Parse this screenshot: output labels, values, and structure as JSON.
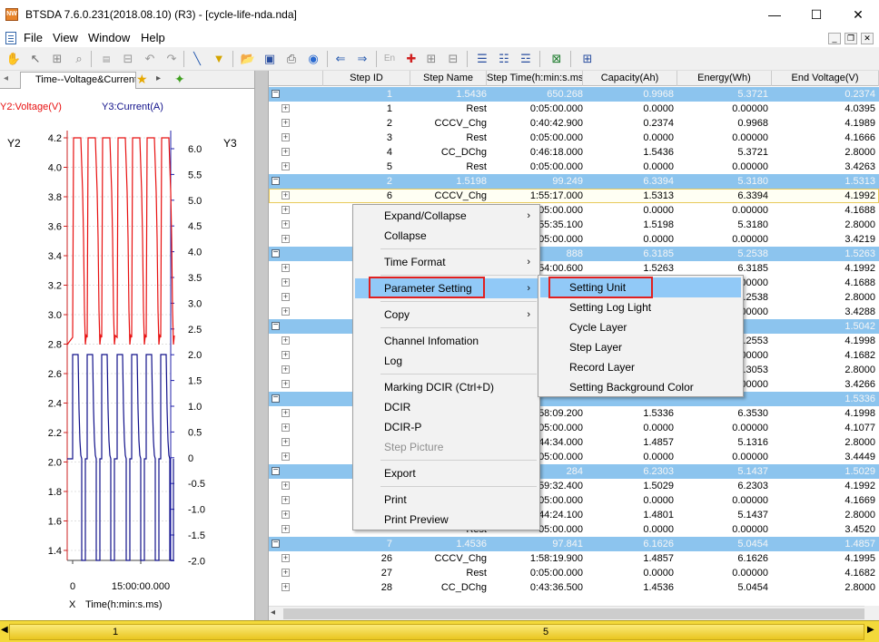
{
  "window": {
    "title": "BTSDA 7.6.0.231(2018.08.10) (R3) - [cycle-life-nda.nda]",
    "app_icon_text": "NW",
    "minimize": "—",
    "maximize": "☐",
    "close": "✕"
  },
  "menubar": {
    "items": [
      "File",
      "View",
      "Window",
      "Help"
    ]
  },
  "chart": {
    "tab_label": "Time--Voltage&Current",
    "y2_legend": "Y2:Voltage(V)",
    "y3_legend": "Y3:Current(A)",
    "y2_title": "Y2",
    "y3_title": "Y3",
    "x_prefix": "X",
    "x_title": "Time(h:min:s.ms)",
    "x_ticks": [
      "0",
      "15:00:00.000"
    ],
    "y2_ticks": [
      "4.2",
      "4.0",
      "3.8",
      "3.6",
      "3.4",
      "3.2",
      "3.0",
      "2.8",
      "2.6",
      "2.4",
      "2.2",
      "2.0",
      "1.8",
      "1.6",
      "1.4"
    ],
    "y3_ticks": [
      "6.0",
      "5.5",
      "5.0",
      "4.5",
      "4.0",
      "3.5",
      "3.0",
      "2.5",
      "2.0",
      "1.5",
      "1.0",
      "0.5",
      "0",
      "-0.5",
      "-1.0",
      "-1.5",
      "-2.0"
    ],
    "colors": {
      "voltage": "#e81010",
      "current": "#10108a",
      "y2_axis": "#cc2020",
      "y3_axis": "#2020aa"
    }
  },
  "table": {
    "columns": [
      "Step ID",
      "Step Name",
      "Step Time(h:min:s.ms)",
      "Capacity(Ah)",
      "Energy(Wh)",
      "End Voltage(V)"
    ],
    "rows": [
      {
        "type": "cycle",
        "id": "1",
        "name": "1.5436",
        "time": "650.268",
        "cap": "0.9968",
        "energy": "5.3721",
        "endv": "0.2374"
      },
      {
        "type": "step",
        "id": "1",
        "name": "Rest",
        "time": "0:05:00.000",
        "cap": "0.0000",
        "energy": "0.00000",
        "endv": "4.0395"
      },
      {
        "type": "step",
        "id": "2",
        "name": "CCCV_Chg",
        "time": "0:40:42.900",
        "cap": "0.2374",
        "energy": "0.9968",
        "endv": "4.1989"
      },
      {
        "type": "step",
        "id": "3",
        "name": "Rest",
        "time": "0:05:00.000",
        "cap": "0.0000",
        "energy": "0.00000",
        "endv": "4.1666"
      },
      {
        "type": "step",
        "id": "4",
        "name": "CC_DChg",
        "time": "0:46:18.000",
        "cap": "1.5436",
        "energy": "5.3721",
        "endv": "2.8000"
      },
      {
        "type": "step",
        "id": "5",
        "name": "Rest",
        "time": "0:05:00.000",
        "cap": "0.0000",
        "energy": "0.00000",
        "endv": "3.4263"
      },
      {
        "type": "cycle",
        "id": "2",
        "name": "1.5198",
        "time": "99.249",
        "cap": "6.3394",
        "energy": "5.3180",
        "endv": "1.5313"
      },
      {
        "type": "step",
        "sel": true,
        "id": "6",
        "name": "CCCV_Chg",
        "time": "1:55:17.000",
        "cap": "1.5313",
        "energy": "6.3394",
        "endv": "4.1992"
      },
      {
        "type": "step",
        "id": "",
        "name": "",
        "time": "05:00.000",
        "cap": "0.0000",
        "energy": "0.00000",
        "endv": "4.1688"
      },
      {
        "type": "step",
        "id": "",
        "name": "",
        "time": "55:35.100",
        "cap": "1.5198",
        "energy": "5.3180",
        "endv": "2.8000"
      },
      {
        "type": "step",
        "id": "",
        "name": "",
        "time": "05:00.000",
        "cap": "0.0000",
        "energy": "0.00000",
        "endv": "3.4219"
      },
      {
        "type": "cycle",
        "id": "",
        "name": "",
        "time": "888",
        "cap": "6.3185",
        "energy": "5.2538",
        "endv": "1.5263"
      },
      {
        "type": "step",
        "id": "",
        "name": "",
        "time": "54:00.600",
        "cap": "1.5263",
        "energy": "6.3185",
        "endv": "4.1992"
      },
      {
        "type": "step",
        "id": "",
        "name": "",
        "time": "",
        "cap": "",
        "energy": "00000",
        "endv": "4.1688"
      },
      {
        "type": "step",
        "id": "",
        "name": "",
        "time": "",
        "cap": "",
        "energy": "5.2538",
        "endv": "2.8000"
      },
      {
        "type": "step",
        "id": "",
        "name": "",
        "time": "",
        "cap": "",
        "energy": "00000",
        "endv": "3.4288"
      },
      {
        "type": "cycle",
        "id": "",
        "name": "",
        "time": "",
        "cap": "",
        "energy": "",
        "endv": "1.5042"
      },
      {
        "type": "step",
        "id": "",
        "name": "",
        "time": "",
        "cap": "",
        "energy": "6.2553",
        "endv": "4.1998"
      },
      {
        "type": "step",
        "id": "",
        "name": "",
        "time": "",
        "cap": "",
        "energy": "00000",
        "endv": "4.1682"
      },
      {
        "type": "step",
        "id": "",
        "name": "",
        "time": "",
        "cap": "",
        "energy": "5.3053",
        "endv": "2.8000"
      },
      {
        "type": "step",
        "id": "",
        "name": "",
        "time": "",
        "cap": "",
        "energy": "00000",
        "endv": "3.4266"
      },
      {
        "type": "cycle",
        "id": "",
        "name": "",
        "time": "",
        "cap": "",
        "energy": "",
        "endv": "1.5336"
      },
      {
        "type": "step",
        "id": "",
        "name": "",
        "time": "58:09.200",
        "cap": "1.5336",
        "energy": "6.3530",
        "endv": "4.1998"
      },
      {
        "type": "step",
        "id": "",
        "name": "",
        "time": "05:00.000",
        "cap": "0.0000",
        "energy": "0.00000",
        "endv": "4.1077"
      },
      {
        "type": "step",
        "id": "",
        "name": "",
        "time": "44:34.000",
        "cap": "1.4857",
        "energy": "5.1316",
        "endv": "2.8000"
      },
      {
        "type": "step",
        "id": "",
        "name": "",
        "time": "05:00.000",
        "cap": "0.0000",
        "energy": "0.00000",
        "endv": "3.4449"
      },
      {
        "type": "cycle",
        "id": "",
        "name": "",
        "time": "284",
        "cap": "6.2303",
        "energy": "5.1437",
        "endv": "1.5029"
      },
      {
        "type": "step",
        "id": "",
        "name": "",
        "time": "59:32.400",
        "cap": "1.5029",
        "energy": "6.2303",
        "endv": "4.1992"
      },
      {
        "type": "step",
        "id": "",
        "name": "",
        "time": "05:00.000",
        "cap": "0.0000",
        "energy": "0.00000",
        "endv": "4.1669"
      },
      {
        "type": "step",
        "id": "",
        "name": "",
        "time": "44:24.100",
        "cap": "1.4801",
        "energy": "5.1437",
        "endv": "2.8000"
      },
      {
        "type": "step",
        "id": "",
        "name": "Rest",
        "time": "05:00.000",
        "cap": "0.0000",
        "energy": "0.00000",
        "endv": "3.4520"
      },
      {
        "type": "cycle",
        "id": "7",
        "name": "1.4536",
        "time": "97.841",
        "cap": "6.1626",
        "energy": "5.0454",
        "endv": "1.4857"
      },
      {
        "type": "step",
        "id": "26",
        "name": "CCCV_Chg",
        "time": "1:58:19.900",
        "cap": "1.4857",
        "energy": "6.1626",
        "endv": "4.1995"
      },
      {
        "type": "step",
        "id": "27",
        "name": "Rest",
        "time": "0:05:00.000",
        "cap": "0.0000",
        "energy": "0.00000",
        "endv": "4.1682"
      },
      {
        "type": "step",
        "id": "28",
        "name": "CC_DChg",
        "time": "0:43:36.500",
        "cap": "1.4536",
        "energy": "5.0454",
        "endv": "2.8000"
      }
    ]
  },
  "context_menu": {
    "items": [
      {
        "label": "Expand/Collapse",
        "arrow": "›"
      },
      {
        "label": "Collapse"
      },
      {
        "sep": true
      },
      {
        "label": "Time Format",
        "arrow": "›"
      },
      {
        "sep": true
      },
      {
        "label": "Parameter Setting",
        "arrow": "›",
        "hot": true
      },
      {
        "sep": true
      },
      {
        "label": "Copy",
        "arrow": "›"
      },
      {
        "sep": true
      },
      {
        "label": "Channel Infomation"
      },
      {
        "label": "Log"
      },
      {
        "sep": true
      },
      {
        "label": "Marking DCIR (Ctrl+D)"
      },
      {
        "label": "DCIR"
      },
      {
        "label": "DCIR-P"
      },
      {
        "label": "Step Picture",
        "disabled": true
      },
      {
        "sep": true
      },
      {
        "label": "Export"
      },
      {
        "sep": true
      },
      {
        "label": "Print"
      },
      {
        "label": "Print Preview"
      }
    ]
  },
  "submenu": {
    "items": [
      {
        "label": "Setting Unit",
        "hot": true
      },
      {
        "label": "Setting Log Light"
      },
      {
        "label": "Cycle Layer"
      },
      {
        "label": "Step Layer"
      },
      {
        "label": "Record Layer"
      },
      {
        "label": "Setting Background Color"
      }
    ]
  },
  "timeline": {
    "labels": [
      "1",
      "5"
    ],
    "left_arrow": "◀",
    "right_arrow": "▶"
  }
}
